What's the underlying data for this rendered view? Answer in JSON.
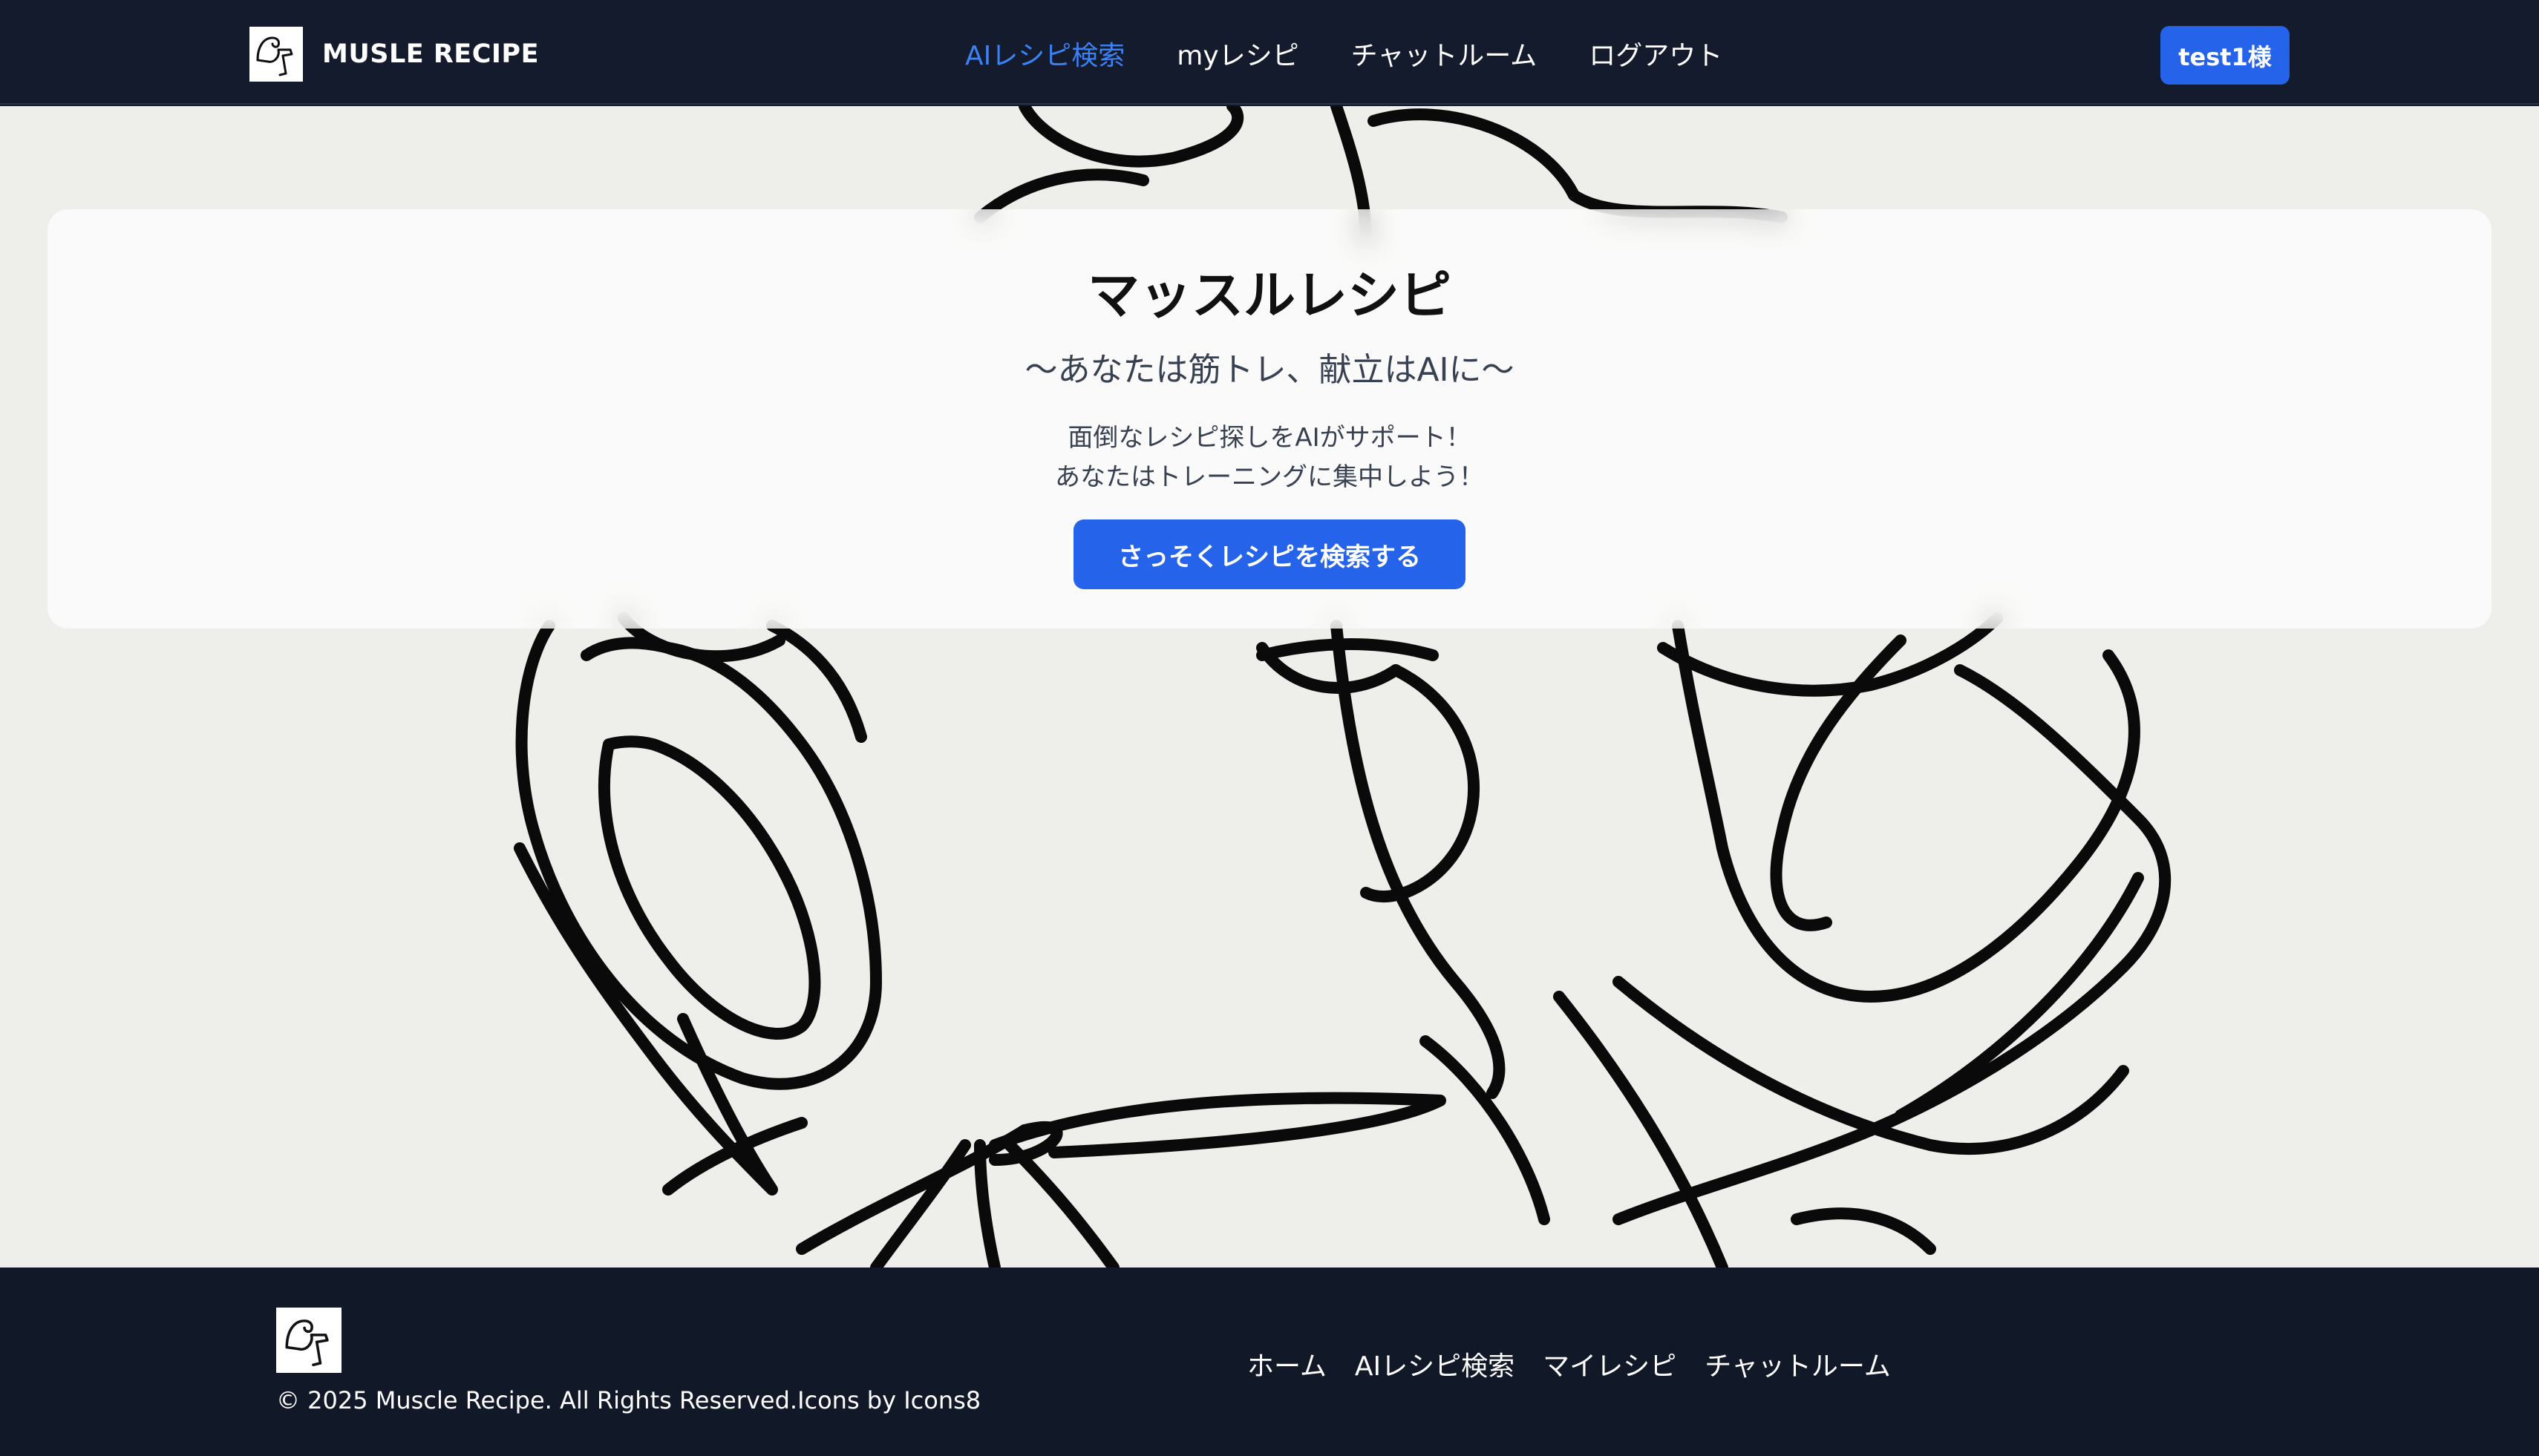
{
  "header": {
    "brand_name": "MUSLE RECIPE",
    "logo_icon": "flexing-arm-icon",
    "nav": [
      {
        "label": "AIレシピ検索",
        "active": true
      },
      {
        "label": "myレシピ",
        "active": false
      },
      {
        "label": "チャットルーム",
        "active": false
      },
      {
        "label": "ログアウト",
        "active": false
      }
    ],
    "user_button": "test1様"
  },
  "hero": {
    "title": "マッスルレシピ",
    "subtitle": "〜あなたは筋トレ、献立はAIに〜",
    "description_line1": "面倒なレシピ探しをAIがサポート！",
    "description_line2": "あなたはトレーニングに集中しよう！",
    "cta_label": "さっそくレシピを検索する",
    "background_image": "line-art-food-illustration"
  },
  "footer": {
    "logo_icon": "flexing-arm-icon",
    "links": [
      "ホーム",
      "AIレシピ検索",
      "マイレシピ",
      "チャットルーム"
    ],
    "copyright": "© 2025 Muscle Recipe. All Rights Reserved.Icons by Icons8"
  },
  "colors": {
    "header_bg": "#141b2c",
    "footer_bg": "#111827",
    "accent": "#2563eb",
    "active_nav": "#3b82f6"
  }
}
